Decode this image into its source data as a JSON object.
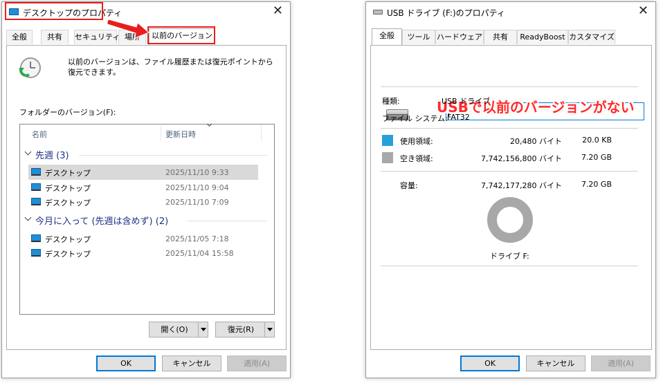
{
  "left_dialog": {
    "title": "デスクトップのプロパティ",
    "tabs": [
      "全般",
      "共有",
      "セキュリティ",
      "場所",
      "以前のバージョン"
    ],
    "active_tab": "以前のバージョン",
    "description": "以前のバージョンは、ファイル履歴または復元ポイントから復元できます。",
    "folder_versions_label": "フォルダーのバージョン(F):",
    "columns": [
      "名前",
      "更新日時"
    ],
    "groups": [
      {
        "header": "先週 (3)",
        "items": [
          {
            "name": "デスクトップ",
            "date": "2025/11/10 9:33"
          },
          {
            "name": "デスクトップ",
            "date": "2025/11/10 9:04"
          },
          {
            "name": "デスクトップ",
            "date": "2025/11/10 7:09"
          }
        ]
      },
      {
        "header": "今月に入って (先週は含めず) (2)",
        "items": [
          {
            "name": "デスクトップ",
            "date": "2025/11/05 7:18"
          },
          {
            "name": "デスクトップ",
            "date": "2025/11/04 15:58"
          }
        ]
      }
    ],
    "open_button": "開く(O)",
    "restore_button": "復元(R)",
    "ok": "OK",
    "cancel": "キャンセル",
    "apply": "適用(A)"
  },
  "right_dialog": {
    "title": "USB ドライブ (F:)のプロパティ",
    "tabs": [
      "全般",
      "ツール",
      "ハードウェア",
      "共有",
      "ReadyBoost",
      "カスタマイズ"
    ],
    "active_tab": "全般",
    "annotation": "USBで以前のバージョンがない",
    "type_label": "種類:",
    "type_value": "USB ドライブ",
    "fs_label": "ファイル システム:",
    "fs_value": "FAT32",
    "used_label": "使用領域:",
    "used_bytes": "20,480 バイト",
    "used_size": "20.0 KB",
    "free_label": "空き領域:",
    "free_bytes": "7,742,156,800 バイト",
    "free_size": "7.20 GB",
    "capacity_label": "容量:",
    "capacity_bytes": "7,742,177,280 バイト",
    "capacity_size": "7.20 GB",
    "drive_label": "ドライブ F:",
    "used_fraction": 2.6e-06,
    "ok": "OK",
    "cancel": "キャンセル",
    "apply": "適用(A)"
  },
  "colors": {
    "used": "#26a0da",
    "free": "#a8a8a8",
    "accent": "#0078d7",
    "highlight": "#e81e1e"
  }
}
